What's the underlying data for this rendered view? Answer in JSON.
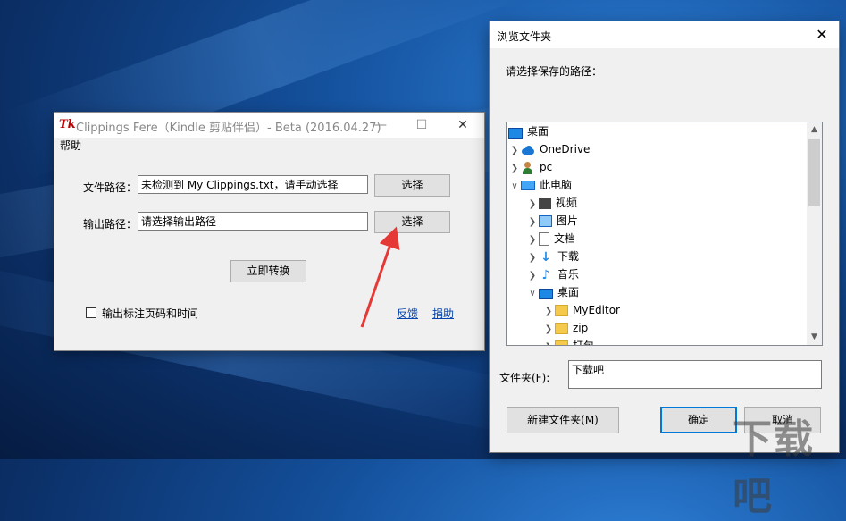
{
  "main_window": {
    "title": "Clippings Fere（Kindle 剪贴伴侣）- Beta (2016.04.27)",
    "app_icon_text": "Tk",
    "minimize": "—",
    "maximize": "☐",
    "close": "✕",
    "menu_help": "帮助",
    "file_path_label": "文件路径：",
    "file_path_value": "未检测到 My Clippings.txt，请手动选择",
    "file_select_button": "选择",
    "output_path_label": "输出路径：",
    "output_path_value": "请选择输出路径",
    "output_select_button": "选择",
    "convert_button": "立即转换",
    "checkbox_label": "输出标注页码和时间",
    "feedback_link": "反馈",
    "donate_link": "捐助"
  },
  "browse_dialog": {
    "title": "浏览文件夹",
    "close": "✕",
    "prompt": "请选择保存的路径：",
    "tree": [
      {
        "label": "桌面",
        "icon": "desktop-icon",
        "chevron": ""
      },
      {
        "label": "OneDrive",
        "icon": "onedrive-icon",
        "chevron": "❯"
      },
      {
        "label": "pc",
        "icon": "user-icon",
        "chevron": "❯"
      },
      {
        "label": "此电脑",
        "icon": "pc-icon",
        "chevron": "∨"
      },
      {
        "label": "视频",
        "icon": "video-icon",
        "chevron": "❯"
      },
      {
        "label": "图片",
        "icon": "picture-icon",
        "chevron": "❯"
      },
      {
        "label": "文档",
        "icon": "document-icon",
        "chevron": "❯"
      },
      {
        "label": "下载",
        "icon": "download-icon",
        "chevron": "❯"
      },
      {
        "label": "音乐",
        "icon": "music-icon",
        "chevron": "❯"
      },
      {
        "label": "桌面",
        "icon": "desktop-icon",
        "chevron": "∨"
      },
      {
        "label": "MyEditor",
        "icon": "folder-icon",
        "chevron": "❯"
      },
      {
        "label": "zip",
        "icon": "folder-icon",
        "chevron": "❯"
      },
      {
        "label": "打包",
        "icon": "folder-icon",
        "chevron": "❯"
      }
    ],
    "folder_label": "文件夹(F):",
    "folder_value": "下载吧",
    "new_folder_button": "新建文件夹(M)",
    "ok_button": "确定",
    "cancel_button": "取消"
  },
  "watermark": "下载吧",
  "colors": {
    "arrow": "#e53935",
    "link": "#0645ad",
    "accent": "#0078d7"
  }
}
